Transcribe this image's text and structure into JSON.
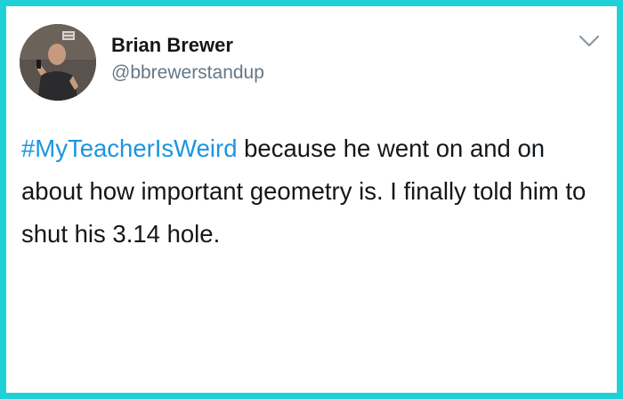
{
  "author": {
    "display_name": "Brian Brewer",
    "handle": "@bbrewerstandup"
  },
  "tweet": {
    "hashtag": "#MyTeacherIsWeird",
    "text_after_hashtag": " because he went on and on about how important geometry is. I finally told him to shut his 3.14 hole."
  },
  "icons": {
    "menu": "chevron-down-icon",
    "avatar": "avatar-photo"
  },
  "colors": {
    "frame": "#1fd0d8",
    "hashtag": "#1b95e0",
    "handle": "#657786",
    "text": "#14171a"
  }
}
